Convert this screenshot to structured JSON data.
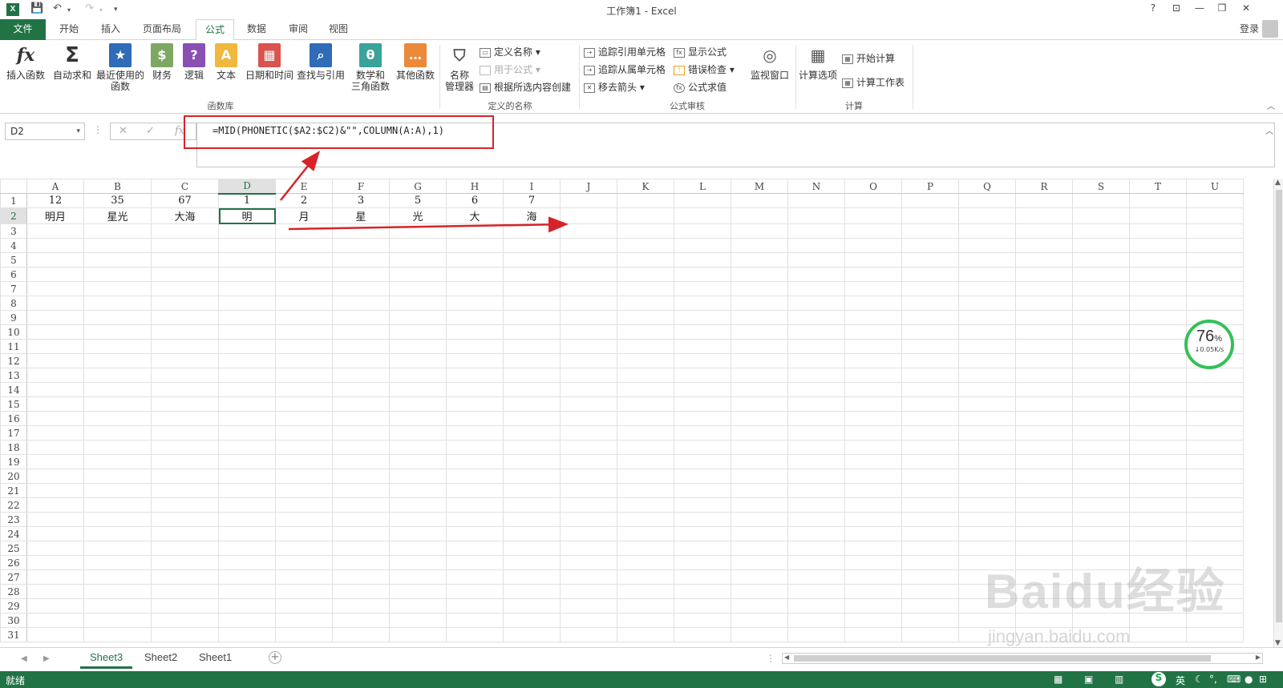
{
  "titlebar": {
    "title": "工作簿1 - Excel",
    "help": "?",
    "restore_ribbon": "⊡",
    "minimize": "—",
    "maximize": "❐",
    "close": "✕"
  },
  "tabs": {
    "file": "文件",
    "home": "开始",
    "insert": "插入",
    "layout": "页面布局",
    "formulas": "公式",
    "data": "数据",
    "review": "审阅",
    "view": "视图",
    "login": "登录"
  },
  "ribbon": {
    "insert_function": "插入函数",
    "autosum": "自动求和",
    "recent_1": "最近使用的",
    "recent_2": "函数",
    "financial": "财务",
    "logical": "逻辑",
    "text": "文本",
    "datetime": "日期和时间",
    "lookup": "查找与引用",
    "math_1": "数学和",
    "math_2": "三角函数",
    "more": "其他函数",
    "group_library": "函数库",
    "name_manager_1": "名称",
    "name_manager_2": "管理器",
    "define_name": "定义名称",
    "use_in_formula": "用于公式",
    "create_from_sel": "根据所选内容创建",
    "group_names": "定义的名称",
    "trace_precedents": "追踪引用单元格",
    "trace_dependents": "追踪从属单元格",
    "remove_arrows": "移去箭头",
    "show_formulas": "显示公式",
    "error_checking": "错误检查",
    "evaluate": "公式求值",
    "watch_window": "监视窗口",
    "group_auditing": "公式审核",
    "calc_options": "计算选项",
    "calc_now": "开始计算",
    "calc_sheet": "计算工作表",
    "group_calc": "计算"
  },
  "formula_bar": {
    "name_box": "D2",
    "formula": "=MID(PHONETIC($A2:$C2)&\"\",COLUMN(A:A),1)",
    "cancel": "✕",
    "enter": "✓",
    "fx": "fx"
  },
  "columns": [
    "A",
    "B",
    "C",
    "D",
    "E",
    "F",
    "G",
    "H",
    "I",
    "J",
    "K",
    "L",
    "M",
    "N",
    "O",
    "P",
    "Q",
    "R",
    "S",
    "T",
    "U"
  ],
  "rows": {
    "r1": [
      "12",
      "35",
      "67",
      "1",
      "2",
      "3",
      "5",
      "6",
      "7",
      "",
      "",
      "",
      "",
      "",
      "",
      "",
      "",
      "",
      "",
      "",
      ""
    ],
    "r2": [
      "明月",
      "星光",
      "大海",
      "明",
      "月",
      "星",
      "光",
      "大",
      "海",
      "",
      "",
      "",
      "",
      "",
      "",
      "",
      "",
      "",
      "",
      "",
      ""
    ]
  },
  "row_numbers": [
    "1",
    "2",
    "3",
    "4",
    "5",
    "6",
    "7",
    "8",
    "9",
    "10",
    "11",
    "12",
    "13",
    "14",
    "15",
    "16",
    "17",
    "18",
    "19",
    "20",
    "21",
    "22",
    "23",
    "24",
    "25",
    "26",
    "27",
    "28",
    "29",
    "30",
    "31"
  ],
  "sheets": {
    "s3": "Sheet3",
    "s2": "Sheet2",
    "s1": "Sheet1",
    "add": "+"
  },
  "status": {
    "text": "就绪",
    "ime": "英"
  },
  "speed_widget": {
    "percent": "76",
    "percent_sign": "%",
    "rate": "↓0.05K/s"
  },
  "watermark": {
    "brand": "Baidu经验",
    "url": "jingyan.baidu.com"
  },
  "colors": {
    "excel_green": "#217346",
    "highlight_red": "#d8232a",
    "ring_green": "#34c058"
  }
}
